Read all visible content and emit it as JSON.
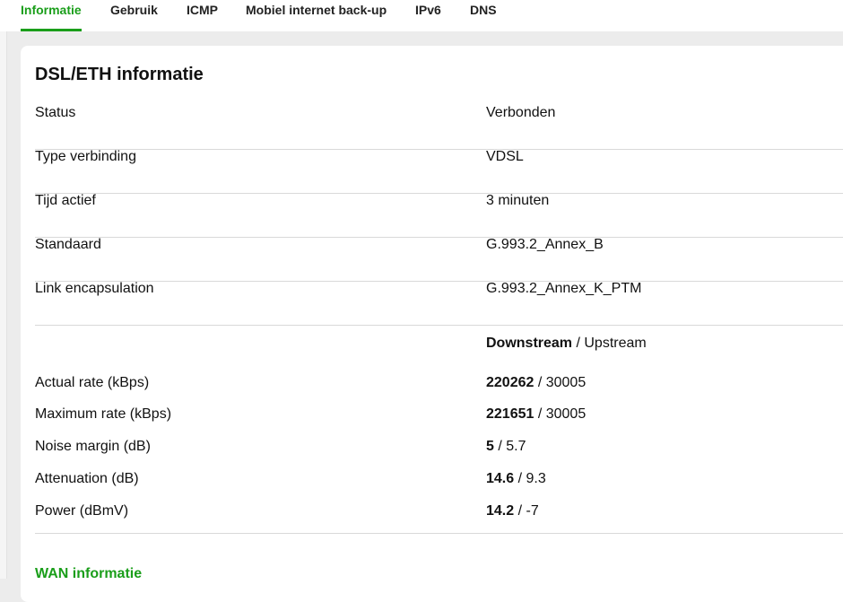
{
  "tabs": [
    {
      "label": "Informatie",
      "active": true
    },
    {
      "label": "Gebruik",
      "active": false
    },
    {
      "label": "ICMP",
      "active": false
    },
    {
      "label": "Mobiel internet back-up",
      "active": false
    },
    {
      "label": "IPv6",
      "active": false
    },
    {
      "label": "DNS",
      "active": false
    }
  ],
  "colors": {
    "accent": "#1a9e1a",
    "background": "#ececec",
    "card": "#ffffff",
    "divider": "#d9d9d9"
  },
  "section": {
    "title": "DSL/ETH informatie",
    "info_rows": [
      {
        "label": "Status",
        "value": "Verbonden"
      },
      {
        "label": "Type verbinding",
        "value": "VDSL"
      },
      {
        "label": "Tijd actief",
        "value": "3 minuten"
      },
      {
        "label": "Standaard",
        "value": "G.993.2_Annex_B"
      },
      {
        "label": "Link encapsulation",
        "value": "G.993.2_Annex_K_PTM"
      }
    ],
    "stats_header": {
      "downstream": "Downstream",
      "separator": " / ",
      "upstream": "Upstream"
    },
    "stats": [
      {
        "label": "Actual rate (kBps)",
        "down": "220262",
        "up": "30005"
      },
      {
        "label": "Maximum rate (kBps)",
        "down": "221651",
        "up": "30005"
      },
      {
        "label": "Noise margin (dB)",
        "down": "5",
        "up": "5.7"
      },
      {
        "label": "Attenuation (dB)",
        "down": "14.6",
        "up": "9.3"
      },
      {
        "label": "Power (dBmV)",
        "down": "14.2",
        "up": "-7"
      }
    ]
  },
  "next_section": {
    "title": "WAN informatie"
  }
}
